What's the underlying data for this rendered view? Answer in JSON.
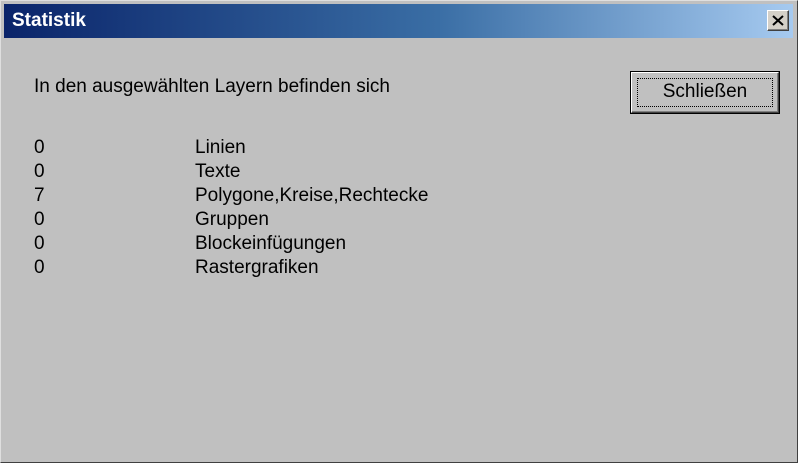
{
  "window": {
    "title": "Statistik",
    "close_icon": "close-icon"
  },
  "dialog": {
    "intro": "In den ausgewählten Layern befinden sich",
    "close_button_label": "Schließen"
  },
  "stats": [
    {
      "count": "0",
      "label": "Linien"
    },
    {
      "count": "0",
      "label": "Texte"
    },
    {
      "count": "7",
      "label": "Polygone,Kreise,Rechtecke"
    },
    {
      "count": "0",
      "label": "Gruppen"
    },
    {
      "count": "0",
      "label": "Blockeinfügungen"
    },
    {
      "count": "0",
      "label": "Rastergrafiken"
    }
  ],
  "colors": {
    "titlebar_start": "#0a246a",
    "titlebar_end": "#a6caf0",
    "dialog_background": "#c0c0c0"
  }
}
